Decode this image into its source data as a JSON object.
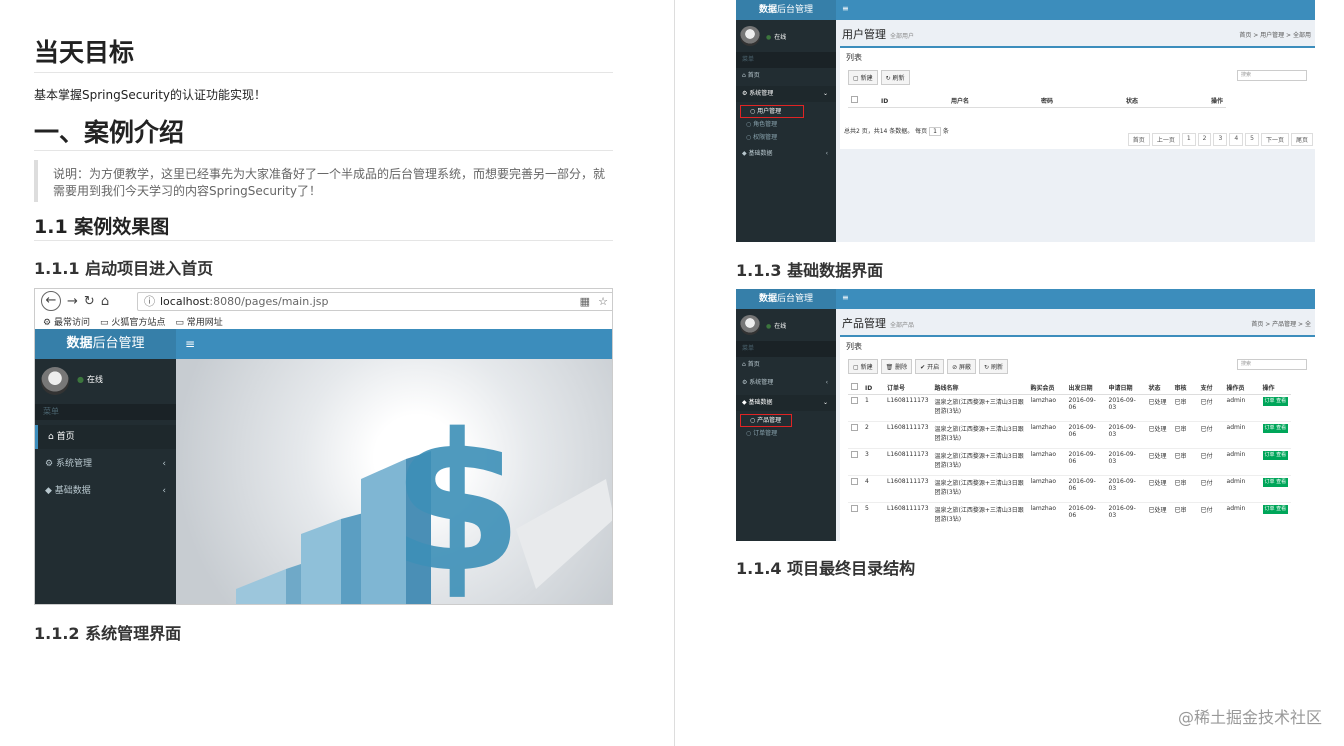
{
  "left": {
    "h1a": "当天目标",
    "p1": "基本掌握SpringSecurity的认证功能实现！",
    "h1b": "一、案例介绍",
    "quote": "说明：为方便教学，这里已经事先为大家准备好了一个半成品的后台管理系统，而想要完善另一部分，就需要用到我们今天学习的内容SpringSecurity了！",
    "h2": "1.1 案例效果图",
    "h3a": "1.1.1 启动项目进入首页",
    "h3b": "1.1.2 系统管理界面"
  },
  "browser": {
    "url_host": "localhost",
    "url_rest": ":8080/pages/main.jsp",
    "bookmarks": [
      "最常访问",
      "火狐官方站点",
      "常用网址"
    ],
    "logo_bold": "数据",
    "logo_rest": "后台管理",
    "status": "在线",
    "nav_header": "菜单",
    "menu": [
      {
        "label": "首页"
      },
      {
        "label": "系统管理"
      },
      {
        "label": "基础数据"
      }
    ]
  },
  "right": {
    "h3c": "1.1.3 基础数据界面",
    "h3d": "1.1.4 项目最终目录结构"
  },
  "users": {
    "logo_bold": "数据",
    "logo_rest": "后台管理",
    "status": "在线",
    "nav_header": "菜单",
    "menu": [
      "首页",
      "系统管理",
      "基础数据"
    ],
    "sub": [
      "用户管理",
      "角色管理",
      "权限管理"
    ],
    "title": "用户管理",
    "subtitle": "全部用户",
    "breadcrumb": "首页 > 用户管理 > 全部用",
    "box_label": "列表",
    "buttons": [
      "新建",
      "刷新"
    ],
    "search": "搜索",
    "columns": [
      "",
      "ID",
      "用户名",
      "密码",
      "状态",
      "操作"
    ],
    "info": "总共2 页，共14 条数据。 每页",
    "per_page": "1",
    "per_unit": "条",
    "pager": [
      "首页",
      "上一页",
      "1",
      "2",
      "3",
      "4",
      "5",
      "下一页",
      "尾页"
    ]
  },
  "products": {
    "logo_bold": "数据",
    "logo_rest": "后台管理",
    "status": "在线",
    "nav_header": "菜单",
    "menu": [
      "首页",
      "系统管理",
      "基础数据"
    ],
    "sub": [
      "产品管理",
      "订单管理"
    ],
    "title": "产品管理",
    "subtitle": "全部产品",
    "breadcrumb": "首页 > 产品管理 > 全",
    "box_label": "列表",
    "buttons": [
      "新建",
      "删除",
      "开启",
      "屏蔽",
      "刷新"
    ],
    "search": "搜索",
    "columns": [
      "",
      "ID",
      "订单号",
      "路线名称",
      "购买会员",
      "出发日期",
      "申请日期",
      "状态",
      "审核",
      "支付",
      "操作员",
      "操作"
    ],
    "rows": [
      {
        "id": "1",
        "no": "L1608111173",
        "route": "温泉之旅(江西婺源+三清山3日跟团游(3钻)",
        "member": "lamzhao",
        "dep": "2016-09-06",
        "app": "2016-09-03",
        "state": "已处理",
        "audit": "已审",
        "pay": "已付",
        "op": "admin",
        "act": "订单 查看"
      },
      {
        "id": "2",
        "no": "L1608111173",
        "route": "温泉之旅(江西婺源+三清山3日跟团游(3钻)",
        "member": "lamzhao",
        "dep": "2016-09-06",
        "app": "2016-09-03",
        "state": "已处理",
        "audit": "已审",
        "pay": "已付",
        "op": "admin",
        "act": "订单 查看"
      },
      {
        "id": "3",
        "no": "L1608111173",
        "route": "温泉之旅(江西婺源+三清山3日跟团游(3钻)",
        "member": "lamzhao",
        "dep": "2016-09-06",
        "app": "2016-09-03",
        "state": "已处理",
        "audit": "已审",
        "pay": "已付",
        "op": "admin",
        "act": "订单 查看"
      },
      {
        "id": "4",
        "no": "L1608111173",
        "route": "温泉之旅(江西婺源+三清山3日跟团游(3钻)",
        "member": "lamzhao",
        "dep": "2016-09-06",
        "app": "2016-09-03",
        "state": "已处理",
        "audit": "已审",
        "pay": "已付",
        "op": "admin",
        "act": "订单 查看"
      },
      {
        "id": "5",
        "no": "L1608111173",
        "route": "温泉之旅(江西婺源+三清山3日跟团游(3钻)",
        "member": "lamzhao",
        "dep": "2016-09-06",
        "app": "2016-09-03",
        "state": "已处理",
        "audit": "已审",
        "pay": "已付",
        "op": "admin",
        "act": "订单 查看"
      }
    ]
  },
  "watermark": "@稀土掘金技术社区"
}
